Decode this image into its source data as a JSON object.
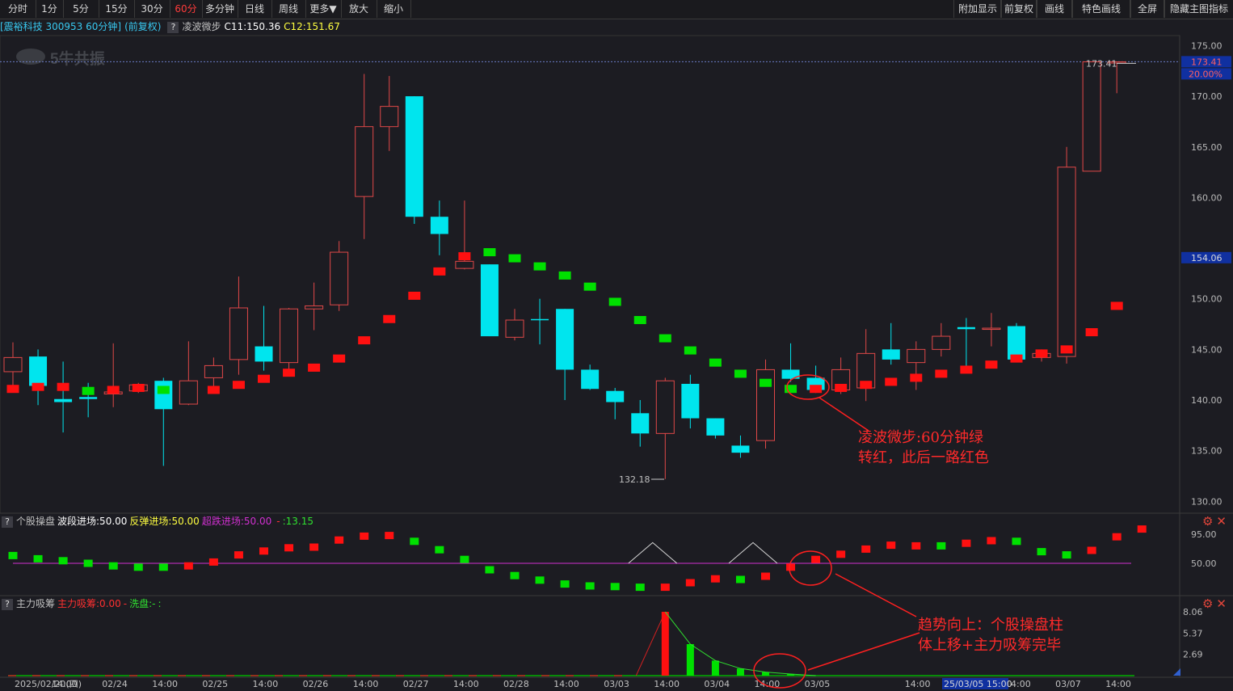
{
  "toolbar": {
    "left_items": [
      "分时",
      "1分",
      "5分",
      "15分",
      "30分",
      "60分",
      "多分钟",
      "日线",
      "周线",
      "更多▼",
      "放大",
      "缩小"
    ],
    "active": "60分",
    "right_items": [
      "附加显示",
      "前复权",
      "画线",
      "特色画线",
      "全屏",
      "隐藏主图指标"
    ]
  },
  "info": {
    "stock": "[震裕科技 300953 60分钟]",
    "adj": "(前复权)",
    "indicator": "凌波微步",
    "c11": "C11:150.36",
    "c12": "C12:151.67"
  },
  "watermark": "5牛共振",
  "price_axis": {
    "ticks": [
      {
        "label": "175.00",
        "v": 175
      },
      {
        "label": "170.00",
        "v": 170
      },
      {
        "label": "165.00",
        "v": 165
      },
      {
        "label": "160.00",
        "v": 160
      },
      {
        "label": "150.00",
        "v": 150
      },
      {
        "label": "145.00",
        "v": 145
      },
      {
        "label": "140.00",
        "v": 140
      },
      {
        "label": "135.00",
        "v": 135
      },
      {
        "label": "130.00",
        "v": 130
      }
    ],
    "high_tag": "173.41",
    "pct_tag": "20.00%",
    "price_tag": "154.06",
    "high_label": "173.41",
    "low_label": "132.18"
  },
  "sub1": {
    "label": "个股操盘",
    "v1": "波段进场:50.00",
    "v2": "反弹进场:50.00",
    "v3": "超跌进场:50.00",
    "v4": "-",
    "v5": ":13.15",
    "ticks": [
      "95.00",
      "50.00"
    ]
  },
  "sub2": {
    "label": "主力吸筹",
    "v1": "主力吸筹:0.00",
    "v2": "-",
    "v3": "洗盘:-",
    "v4": ":",
    "ticks": [
      "8.06",
      "5.37",
      "2.69"
    ]
  },
  "date_axis": [
    "2025/02/20(四)",
    "14:00",
    "02/24",
    "14:00",
    "02/25",
    "14:00",
    "02/26",
    "14:00",
    "02/27",
    "14:00",
    "02/28",
    "14:00",
    "03/03",
    "14:00",
    "03/04",
    "14:00",
    "03/05",
    "14:00",
    "14:00",
    "03/07",
    "14:00"
  ],
  "date_cursor": "25/03/05 15:00",
  "annotations": {
    "a1_line1": "凌波微步:60分钟绿",
    "a1_line2": "转红，此后一路红色",
    "a2_line1": "趋势向上：个股操盘柱",
    "a2_line2": "体上移+主力吸筹完毕"
  },
  "colors": {
    "up": "#e04848",
    "down": "#00e5ee",
    "red": "#ff1010",
    "green": "#00e000",
    "magenta": "#d030d0",
    "yellow": "#ffff40",
    "cyan": "#40e0ff",
    "bg": "#1c1c22"
  },
  "chart_data": {
    "type": "candlestick",
    "candles": [
      {
        "o": 142.8,
        "c": 144.2,
        "h": 145.7,
        "l": 141.2
      },
      {
        "o": 144.3,
        "c": 141.4,
        "h": 145.0,
        "l": 139.5
      },
      {
        "o": 140.1,
        "c": 139.8,
        "h": 143.8,
        "l": 136.8
      },
      {
        "o": 140.3,
        "c": 140.1,
        "h": 141.7,
        "l": 138.3
      },
      {
        "o": 140.6,
        "c": 140.8,
        "h": 145.6,
        "l": 139.3
      },
      {
        "o": 140.9,
        "c": 141.5,
        "h": 141.7,
        "l": 140.7
      },
      {
        "o": 141.9,
        "c": 139.1,
        "h": 142.2,
        "l": 133.5
      },
      {
        "o": 139.6,
        "c": 141.9,
        "h": 145.8,
        "l": 139.5
      },
      {
        "o": 142.2,
        "c": 143.4,
        "h": 144.2,
        "l": 140.9
      },
      {
        "o": 144.0,
        "c": 149.1,
        "h": 152.2,
        "l": 142.5
      },
      {
        "o": 145.3,
        "c": 143.8,
        "h": 149.3,
        "l": 142.9
      },
      {
        "o": 143.7,
        "c": 149.0,
        "h": 149.1,
        "l": 142.5
      },
      {
        "o": 149.0,
        "c": 149.3,
        "h": 151.6,
        "l": 146.9
      },
      {
        "o": 149.4,
        "c": 154.6,
        "h": 155.7,
        "l": 148.8
      },
      {
        "o": 160.1,
        "c": 167.0,
        "h": 172.2,
        "l": 155.9
      },
      {
        "o": 167.0,
        "c": 169.0,
        "h": 172.0,
        "l": 164.6
      },
      {
        "o": 170.0,
        "c": 158.1,
        "h": 170.0,
        "l": 157.4
      },
      {
        "o": 158.1,
        "c": 156.4,
        "h": 159.7,
        "l": 154.3
      },
      {
        "o": 153.0,
        "c": 153.7,
        "h": 159.7,
        "l": 152.9
      },
      {
        "o": 153.4,
        "c": 146.3,
        "h": 153.4,
        "l": 146.3
      },
      {
        "o": 146.2,
        "c": 147.9,
        "h": 149.0,
        "l": 145.9
      },
      {
        "o": 148.0,
        "c": 147.9,
        "h": 150.0,
        "l": 145.5
      },
      {
        "o": 149.0,
        "c": 143.0,
        "h": 149.0,
        "l": 140.0
      },
      {
        "o": 143.0,
        "c": 141.1,
        "h": 143.5,
        "l": 141.0
      },
      {
        "o": 140.9,
        "c": 139.8,
        "h": 141.2,
        "l": 138.1
      },
      {
        "o": 138.7,
        "c": 136.7,
        "h": 140.0,
        "l": 135.4
      },
      {
        "o": 136.7,
        "c": 141.9,
        "h": 142.2,
        "l": 132.2
      },
      {
        "o": 141.6,
        "c": 138.2,
        "h": 142.5,
        "l": 137.2
      },
      {
        "o": 138.2,
        "c": 136.5,
        "h": 138.2,
        "l": 136.2
      },
      {
        "o": 135.5,
        "c": 134.8,
        "h": 136.5,
        "l": 134.3
      },
      {
        "o": 136.0,
        "c": 143.0,
        "h": 144.0,
        "l": 135.2
      },
      {
        "o": 143.0,
        "c": 142.1,
        "h": 145.6,
        "l": 141.8
      },
      {
        "o": 142.2,
        "c": 141.0,
        "h": 143.4,
        "l": 140.7
      },
      {
        "o": 141.0,
        "c": 143.0,
        "h": 144.2,
        "l": 140.6
      },
      {
        "o": 141.2,
        "c": 144.6,
        "h": 147.0,
        "l": 139.9
      },
      {
        "o": 145.0,
        "c": 144.0,
        "h": 147.6,
        "l": 143.5
      },
      {
        "o": 143.7,
        "c": 145.0,
        "h": 145.8,
        "l": 141.0
      },
      {
        "o": 145.0,
        "c": 146.3,
        "h": 147.6,
        "l": 144.3
      },
      {
        "o": 147.2,
        "c": 147.0,
        "h": 148.1,
        "l": 142.9
      },
      {
        "o": 147.0,
        "c": 147.1,
        "h": 148.6,
        "l": 145.3
      },
      {
        "o": 147.3,
        "c": 144.0,
        "h": 147.6,
        "l": 143.9
      },
      {
        "o": 144.2,
        "c": 144.6,
        "h": 145.0,
        "l": 143.8
      },
      {
        "o": 144.3,
        "c": 163.0,
        "h": 165.0,
        "l": 143.6
      },
      {
        "o": 162.6,
        "c": 173.4,
        "h": 173.4,
        "l": 162.6
      },
      {
        "o": 173.4,
        "c": 173.4,
        "h": 173.4,
        "l": 170.3
      }
    ],
    "lbwb": [
      {
        "v": 141.1,
        "c": "r"
      },
      {
        "v": 141.3,
        "c": "r"
      },
      {
        "v": 141.3,
        "c": "r"
      },
      {
        "v": 140.9,
        "c": "g"
      },
      {
        "v": 141.0,
        "c": "r"
      },
      {
        "v": 141.2,
        "c": "r"
      },
      {
        "v": 141.0,
        "c": "g"
      },
      {
        "v": null,
        "c": "r"
      },
      {
        "v": 141.0,
        "c": "r"
      },
      {
        "v": 141.5,
        "c": "r"
      },
      {
        "v": 142.1,
        "c": "r"
      },
      {
        "v": 142.7,
        "c": "r"
      },
      {
        "v": 143.2,
        "c": "r"
      },
      {
        "v": 144.1,
        "c": "r"
      },
      {
        "v": 145.9,
        "c": "r"
      },
      {
        "v": 148.0,
        "c": "r"
      },
      {
        "v": 150.3,
        "c": "r"
      },
      {
        "v": 152.7,
        "c": "r"
      },
      {
        "v": 154.2,
        "c": "r"
      },
      {
        "v": 154.6,
        "c": "g"
      },
      {
        "v": 154.0,
        "c": "g"
      },
      {
        "v": 153.2,
        "c": "g"
      },
      {
        "v": 152.3,
        "c": "g"
      },
      {
        "v": 151.2,
        "c": "g"
      },
      {
        "v": 149.7,
        "c": "g"
      },
      {
        "v": 147.9,
        "c": "g"
      },
      {
        "v": 146.1,
        "c": "g"
      },
      {
        "v": 144.9,
        "c": "g"
      },
      {
        "v": 143.7,
        "c": "g"
      },
      {
        "v": 142.6,
        "c": "g"
      },
      {
        "v": 141.7,
        "c": "g"
      },
      {
        "v": 141.1,
        "c": "g"
      },
      {
        "v": 141.1,
        "c": "r"
      },
      {
        "v": 141.2,
        "c": "r"
      },
      {
        "v": 141.5,
        "c": "r"
      },
      {
        "v": 141.8,
        "c": "r"
      },
      {
        "v": 142.2,
        "c": "r"
      },
      {
        "v": 142.6,
        "c": "r"
      },
      {
        "v": 143.0,
        "c": "r"
      },
      {
        "v": 143.5,
        "c": "r"
      },
      {
        "v": 144.1,
        "c": "r"
      },
      {
        "v": 144.6,
        "c": "r"
      },
      {
        "v": 145.0,
        "c": "r"
      },
      {
        "v": 146.7,
        "c": "r"
      },
      {
        "v": 149.3,
        "c": "r"
      }
    ],
    "gpcp": [
      {
        "v": 62,
        "c": "g"
      },
      {
        "v": 57,
        "c": "g"
      },
      {
        "v": 54,
        "c": "g"
      },
      {
        "v": 50,
        "c": "g"
      },
      {
        "v": 46,
        "c": "g"
      },
      {
        "v": 44,
        "c": "g"
      },
      {
        "v": 44,
        "c": "g"
      },
      {
        "v": 46,
        "c": "r"
      },
      {
        "v": 52,
        "c": "r"
      },
      {
        "v": 63,
        "c": "r"
      },
      {
        "v": 69,
        "c": "r"
      },
      {
        "v": 74,
        "c": "r"
      },
      {
        "v": 75,
        "c": "r"
      },
      {
        "v": 86,
        "c": "r"
      },
      {
        "v": 92,
        "c": "r"
      },
      {
        "v": 93,
        "c": "r"
      },
      {
        "v": 84,
        "c": "g"
      },
      {
        "v": 71,
        "c": "g"
      },
      {
        "v": 56,
        "c": "g"
      },
      {
        "v": 40,
        "c": "g"
      },
      {
        "v": 31,
        "c": "g"
      },
      {
        "v": 24,
        "c": "g"
      },
      {
        "v": 18,
        "c": "g"
      },
      {
        "v": 15,
        "c": "g"
      },
      {
        "v": 14,
        "c": "g"
      },
      {
        "v": 13,
        "c": "g"
      },
      {
        "v": 13,
        "c": "r"
      },
      {
        "v": 20,
        "c": "r"
      },
      {
        "v": 26,
        "c": "r"
      },
      {
        "v": 25,
        "c": "g"
      },
      {
        "v": 30,
        "c": "r"
      },
      {
        "v": 44,
        "c": "r"
      },
      {
        "v": 56,
        "c": "r"
      },
      {
        "v": 64,
        "c": "r"
      },
      {
        "v": 72,
        "c": "r"
      },
      {
        "v": 78,
        "c": "r"
      },
      {
        "v": 77,
        "c": "r"
      },
      {
        "v": 77,
        "c": "g"
      },
      {
        "v": 81,
        "c": "r"
      },
      {
        "v": 85,
        "c": "r"
      },
      {
        "v": 84,
        "c": "g"
      },
      {
        "v": 68,
        "c": "g"
      },
      {
        "v": 63,
        "c": "g"
      },
      {
        "v": 70,
        "c": "r"
      },
      {
        "v": 91,
        "c": "r"
      },
      {
        "v": 103,
        "c": "r"
      }
    ],
    "zlxc": [
      {
        "i": 26,
        "v": 8.06,
        "c": "r"
      },
      {
        "i": 27,
        "v": 3.98,
        "c": "g"
      },
      {
        "i": 28,
        "v": 1.9,
        "c": "g"
      },
      {
        "i": 29,
        "v": 0.9,
        "c": "g"
      },
      {
        "i": 30,
        "v": 0.45,
        "c": "g"
      },
      {
        "i": 31,
        "v": 0.2,
        "c": "g"
      }
    ],
    "sub1_triangles": [
      25.5,
      29.5
    ],
    "sub1_line_start": 0,
    "sub1_line_end": 45
  }
}
